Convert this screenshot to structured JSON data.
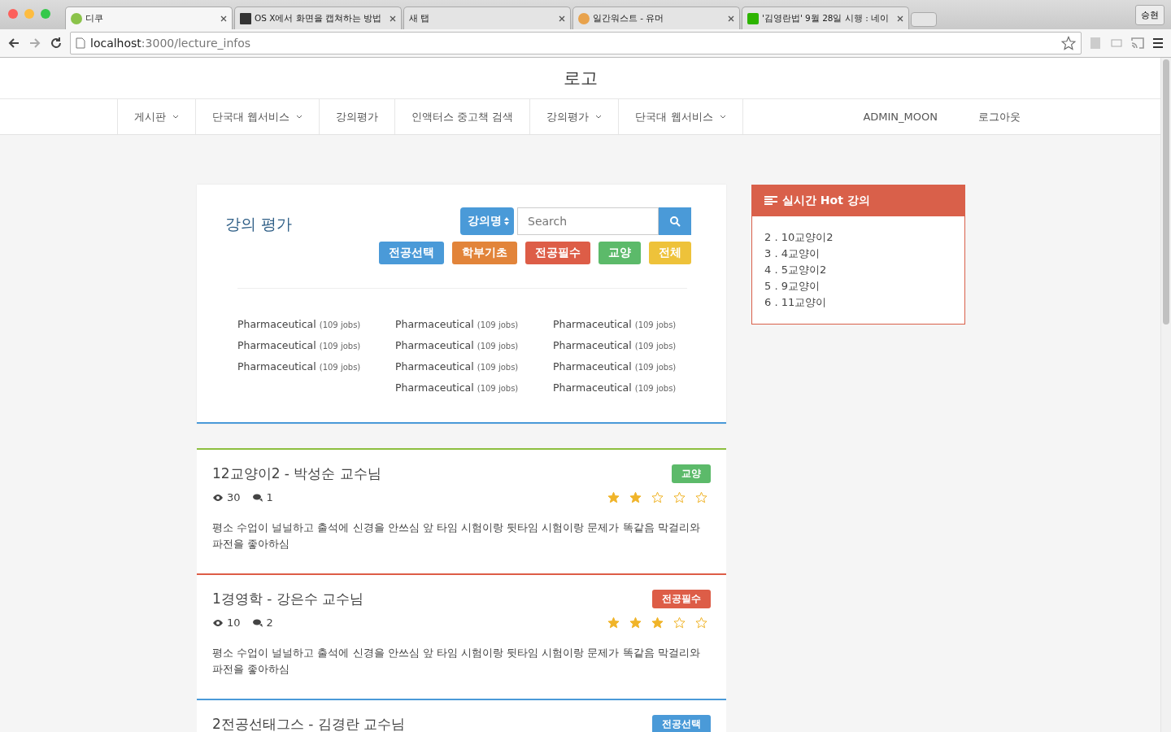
{
  "browser": {
    "tabs": [
      {
        "title": "디쿠",
        "selected": true,
        "kind": "leaf"
      },
      {
        "title": "OS X에서 화면을 캡쳐하는 방법",
        "selected": false,
        "kind": "dark"
      },
      {
        "title": "새 탭",
        "selected": false,
        "kind": "none"
      },
      {
        "title": "일간워스트 - 유머",
        "selected": false,
        "kind": "cat"
      },
      {
        "title": "'김영란법' 9월 28일 시행 : 네이",
        "selected": false,
        "kind": "naver"
      }
    ],
    "profile": "승현",
    "url_host": "localhost",
    "url_path": ":3000/lecture_infos"
  },
  "logo": "로고",
  "nav": {
    "items": [
      {
        "label": "게시판",
        "dropdown": true
      },
      {
        "label": "단국대 웹서비스",
        "dropdown": true
      },
      {
        "label": "강의평가",
        "dropdown": false
      },
      {
        "label": "인액터스 중고책 검색",
        "dropdown": false
      },
      {
        "label": "강의평가",
        "dropdown": true
      },
      {
        "label": "단국대 웹서비스",
        "dropdown": true
      }
    ],
    "user": "ADMIN_MOON",
    "logout": "로그아웃"
  },
  "search_panel": {
    "title": "강의 평가",
    "select": "강의명",
    "placeholder": "Search",
    "filters": [
      {
        "label": "전공선택",
        "color": "#4a9ad8"
      },
      {
        "label": "학부기초",
        "color": "#e2843a"
      },
      {
        "label": "전공필수",
        "color": "#dd5d47"
      },
      {
        "label": "교양",
        "color": "#5cba6a"
      },
      {
        "label": "전체",
        "color": "#eec23a"
      }
    ],
    "columns": [
      [
        {
          "name": "Pharmaceutical",
          "count": "(109 jobs)"
        },
        {
          "name": "Pharmaceutical",
          "count": "(109 jobs)"
        },
        {
          "name": "Pharmaceutical",
          "count": "(109 jobs)"
        }
      ],
      [
        {
          "name": "Pharmaceutical",
          "count": "(109 jobs)"
        },
        {
          "name": "Pharmaceutical",
          "count": "(109 jobs)"
        },
        {
          "name": "Pharmaceutical",
          "count": "(109 jobs)"
        },
        {
          "name": "Pharmaceutical",
          "count": "(109 jobs)"
        }
      ],
      [
        {
          "name": "Pharmaceutical",
          "count": "(109 jobs)"
        },
        {
          "name": "Pharmaceutical",
          "count": "(109 jobs)"
        },
        {
          "name": "Pharmaceutical",
          "count": "(109 jobs)"
        },
        {
          "name": "Pharmaceutical",
          "count": "(109 jobs)"
        }
      ]
    ]
  },
  "reviews": [
    {
      "title": "12교양이2 - 박성순 교수님",
      "tag": {
        "label": "교양",
        "color": "#5cba6a"
      },
      "color": "#8cbf3f",
      "views": "30",
      "comments": "1",
      "stars": 2,
      "body": "평소 수업이 널널하고 출석에 신경을 안쓰심 앞 타임 시험이랑 뒷타임 시험이랑 문제가 똑같음 막걸리와 파전을 좋아하심"
    },
    {
      "title": "1경영학 - 강은수 교수님",
      "tag": {
        "label": "전공필수",
        "color": "#dd5d47"
      },
      "color": "#dd5d47",
      "views": "10",
      "comments": "2",
      "stars": 3,
      "body": "평소 수업이 널널하고 출석에 신경을 안쓰심 앞 타임 시험이랑 뒷타임 시험이랑 문제가 똑같음 막걸리와 파전을 좋아하심"
    },
    {
      "title": "2전공선태그스 - 김경란 교수님",
      "tag": {
        "label": "전공선택",
        "color": "#4a9ad8"
      },
      "color": "#4a9ad8"
    }
  ],
  "hot": {
    "title": "실시간 Hot 강의",
    "items": [
      "2 . 10교양이2",
      "3 . 4교양이",
      "4 . 5교양이2",
      "5 . 9교양이",
      "6 . 11교양이"
    ]
  }
}
